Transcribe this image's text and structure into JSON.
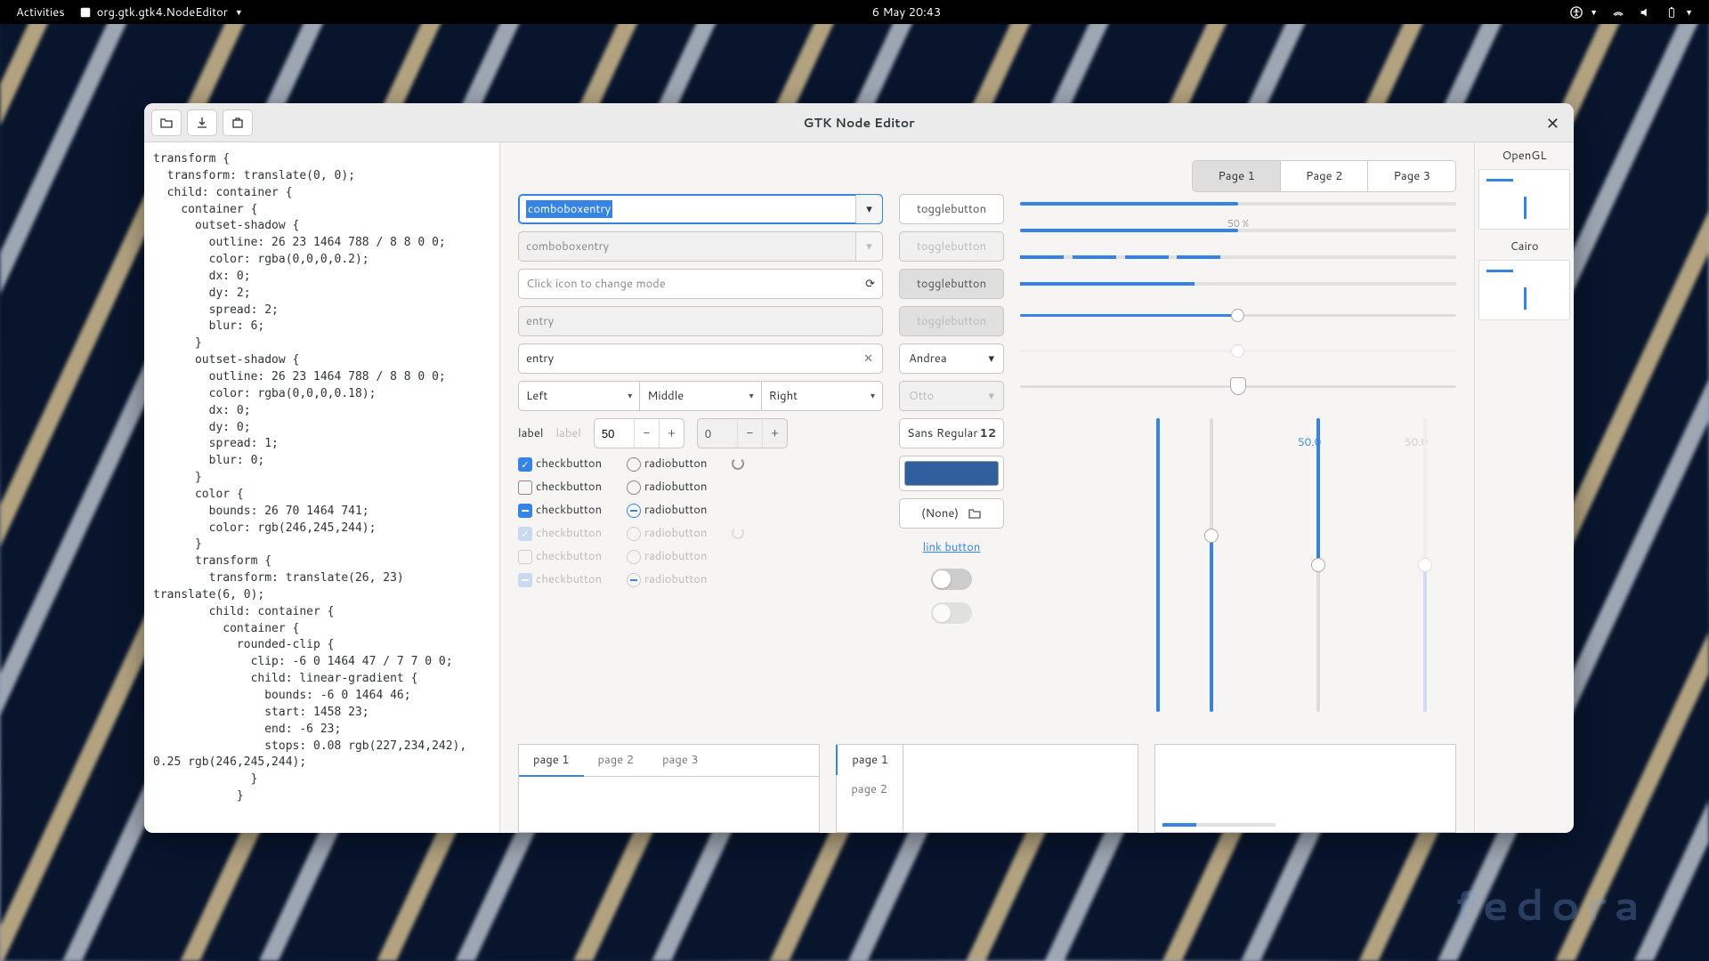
{
  "topbar": {
    "activities": "Activities",
    "app": "org.gtk.gtk4.NodeEditor",
    "clock": "6 May  20:43"
  },
  "window": {
    "title": "GTK Node Editor"
  },
  "code": "transform {\n  transform: translate(0, 0);\n  child: container {\n    container {\n      outset-shadow {\n        outline: 26 23 1464 788 / 8 8 0 0;\n        color: rgba(0,0,0,0.2);\n        dx: 0;\n        dy: 2;\n        spread: 2;\n        blur: 6;\n      }\n      outset-shadow {\n        outline: 26 23 1464 788 / 8 8 0 0;\n        color: rgba(0,0,0,0.18);\n        dx: 0;\n        dy: 0;\n        spread: 1;\n        blur: 0;\n      }\n      color {\n        bounds: 26 70 1464 741;\n        color: rgb(246,245,244);\n      }\n      transform {\n        transform: translate(26, 23)\ntranslate(6, 0);\n        child: container {\n          container {\n            rounded-clip {\n              clip: -6 0 1464 47 / 7 7 0 0;\n              child: linear-gradient {\n                bounds: -6 0 1464 46;\n                start: 1458 23;\n                end: -6 23;\n                stops: 0.08 rgb(227,234,242),\n0.25 rgb(246,245,244);\n              }\n            }",
  "renderers": {
    "r1": "OpenGL",
    "r2": "Cairo"
  },
  "notebook": {
    "p1": "Page 1",
    "p2": "Page 2",
    "p3": "Page 3"
  },
  "widgets": {
    "combo1": "comboboxentry",
    "combo2_ph": "comboboxentry",
    "mode_ph": "Click icon to change mode",
    "entry_ph": "entry",
    "entry_val": "entry",
    "left": "Left",
    "middle": "Middle",
    "right": "Right",
    "label": "label",
    "label2": "label",
    "spin1": "50",
    "spin2": "0",
    "check": "checkbutton",
    "radio": "radiobutton",
    "toggle": "togglebutton",
    "andrea": "Andrea",
    "otto": "Otto",
    "font_name": "Sans Regular",
    "font_size": "12",
    "file_none": "(None)",
    "link": "link button",
    "pct": "50 %",
    "v50a": "50.0",
    "v50b": "50.0",
    "btab1": "page 1",
    "btab2": "page 2",
    "btab3": "page 3"
  },
  "colors": {
    "accent": "#3584e4",
    "swatch": "#2f5f9e"
  },
  "fedora": "fedora"
}
